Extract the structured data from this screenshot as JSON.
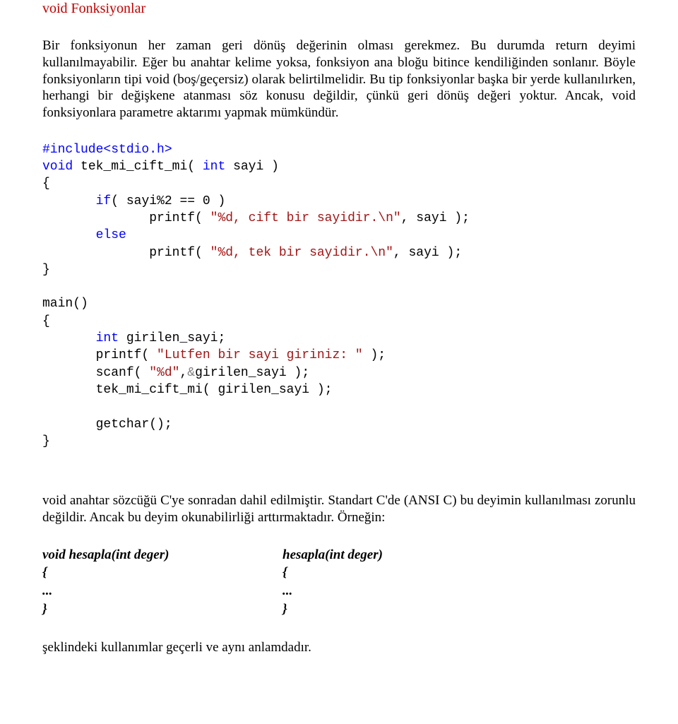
{
  "title": "void Fonksiyonlar",
  "paragraph1": "Bir fonksiyonun her zaman geri dönüş değerinin olması gerekmez. Bu durumda return deyimi kullanılmayabilir. Eğer bu anahtar kelime yoksa, fonksiyon ana bloğu bitince kendiliğinden sonlanır. Böyle fonksiyonların tipi void (boş/geçersiz) olarak belirtilmelidir. Bu tip fonksiyonlar başka bir yerde kullanılırken, herhangi bir değişkene atanması söz konusu değildir, çünkü geri dönüş değeri yoktur. Ancak, void fonksiyonlara parametre aktarımı yapmak mümkündür.",
  "code": {
    "include": "#include<stdio.h>",
    "line2_kw1": "void",
    "line2_rest": " tek_mi_cift_mi( ",
    "line2_kw2": "int",
    "line2_rest2": " sayi )",
    "brace_open": "{",
    "line4_indent": "       ",
    "line4_kw": "if",
    "line4_rest": "( sayi%2 == 0 )",
    "line5_indent": "              ",
    "line5_call": "printf( ",
    "line5_str": "\"%d, cift bir sayidir.\\n\"",
    "line5_rest": ", sayi );",
    "line6_indent": "       ",
    "line6_kw": "else",
    "line7_indent": "              ",
    "line7_call": "printf( ",
    "line7_str": "\"%d, tek bir sayidir.\\n\"",
    "line7_rest": ", sayi );",
    "brace_close": "}",
    "main_sig": "main()",
    "m_line1_indent": "       ",
    "m_line1_kw": "int",
    "m_line1_rest": " girilen_sayi;",
    "m_line2_indent": "       ",
    "m_line2_call": "printf( ",
    "m_line2_str": "\"Lutfen bir sayi giriniz: \"",
    "m_line2_rest": " );",
    "m_line3_indent": "       ",
    "m_line3_call": "scanf( ",
    "m_line3_str": "\"%d\"",
    "m_line3_comma": ",",
    "m_line3_amp": "&",
    "m_line3_rest": "girilen_sayi );",
    "m_line4_indent": "       ",
    "m_line4": "tek_mi_cift_mi( girilen_sayi );",
    "m_line5_indent": "       ",
    "m_line5": "getchar();"
  },
  "paragraph2": "void anahtar sözcüğü C'ye sonradan dahil edilmiştir. Standart C'de (ANSI C) bu deyimin kullanılması zorunlu değildir. Ancak bu deyim okunabilirliği arttırmaktadır. Örneğin:",
  "compare": {
    "left": "void hesapla(int deger)\n{\n...\n}",
    "right": "hesapla(int deger)\n{\n...\n}"
  },
  "footer": "şeklindeki kullanımlar geçerli ve aynı anlamdadır."
}
